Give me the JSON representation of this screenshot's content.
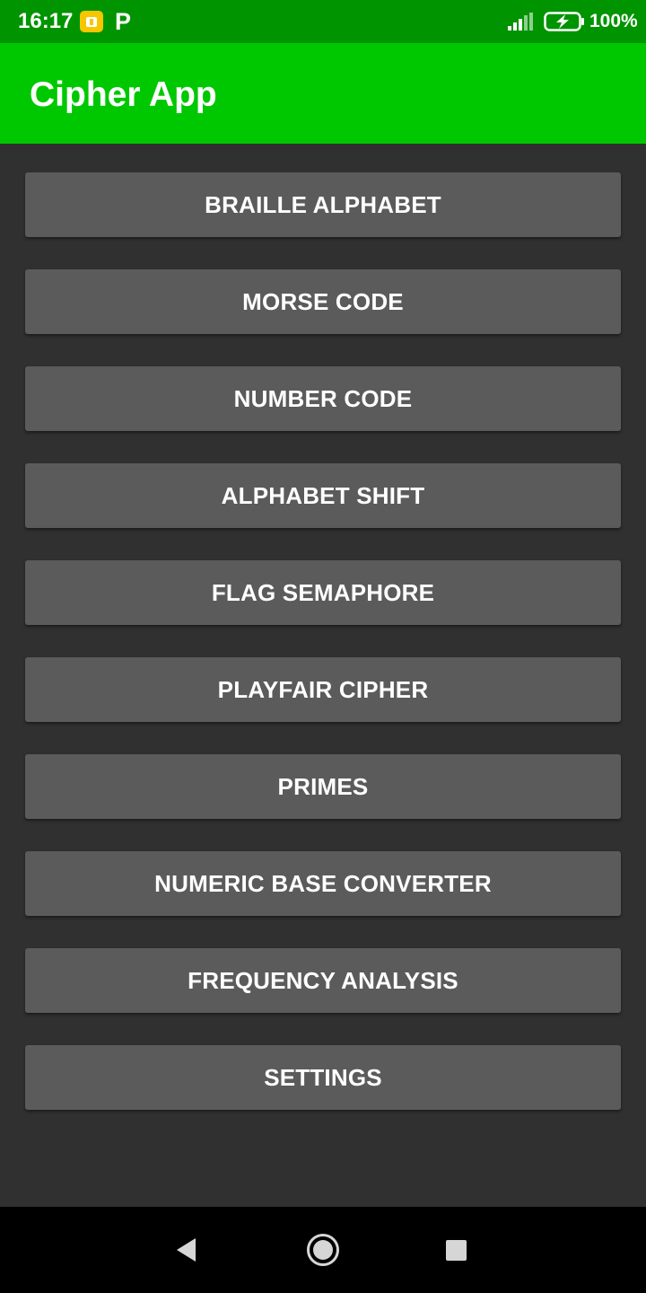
{
  "status_bar": {
    "time": "16:17",
    "notification_icons": [
      "app-notification-icon",
      "p-icon"
    ],
    "p_icon_glyph": "P",
    "signal_icon": "signal-icon",
    "battery_icon": "battery-charging-icon",
    "battery_percent": "100%"
  },
  "app_bar": {
    "title": "Cipher App",
    "background": "#00c800"
  },
  "menu": {
    "items": [
      {
        "label": "BRAILLE ALPHABET"
      },
      {
        "label": "MORSE CODE"
      },
      {
        "label": "NUMBER CODE"
      },
      {
        "label": "ALPHABET SHIFT"
      },
      {
        "label": "FLAG SEMAPHORE"
      },
      {
        "label": "PLAYFAIR CIPHER"
      },
      {
        "label": "PRIMES"
      },
      {
        "label": "NUMERIC BASE CONVERTER"
      },
      {
        "label": "FREQUENCY ANALYSIS"
      },
      {
        "label": "SETTINGS"
      }
    ]
  },
  "nav_bar": {
    "back_icon": "back-icon",
    "home_icon": "home-icon",
    "recents_icon": "recents-icon"
  },
  "colors": {
    "status_bar": "#009400",
    "app_bar": "#00c800",
    "background": "#303030",
    "button": "#5b5b5c",
    "button_text": "#ffffff",
    "nav_bar": "#000000"
  }
}
